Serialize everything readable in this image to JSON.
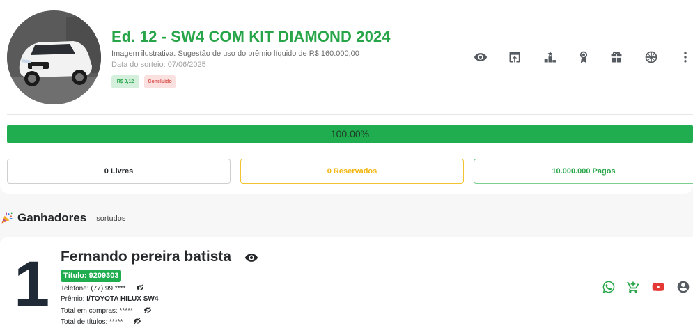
{
  "raffle": {
    "title": "Ed. 12 - SW4 COM KIT DIAMOND 2024",
    "subtitle": "Imagem ilustrativa. Sugestão de uso do prêmio líquido de R$ 160.000,00",
    "draw_date": "Data do sorteio: 07/06/2025",
    "price_badge": "R$ 0,12",
    "status_badge": "Concluído",
    "image_icon": "car-photo"
  },
  "toolbar": {
    "icons": [
      "eye-icon",
      "open-in-icon",
      "podium-icon",
      "award-icon",
      "gift-icon",
      "wheel-icon",
      "more-vert-icon"
    ]
  },
  "progress": {
    "percent": 100.0,
    "label": "100.00%"
  },
  "stats": {
    "free": "0 Livres",
    "reserved": "0 Reservados",
    "paid": "10.000.000 Pagos"
  },
  "winners": {
    "title": "Ganhadores",
    "subtitle": "sortudos",
    "items": [
      {
        "place": "1",
        "name": "Fernando pereira batista",
        "ticket": "Título: 9209303",
        "phone": "Telefone: (77) 99 ****",
        "prize_label": "Prêmio:",
        "prize": "I/TOYOTA HILUX SW4",
        "total_purchases": "Total em compras: *****",
        "total_tickets": "Total de títulos: *****"
      }
    ]
  },
  "colors": {
    "accent_green": "#27a548",
    "progress_green": "#1fad4f",
    "reserved_yellow": "#f2b611",
    "status_red": "#d9534f",
    "whatsapp_green": "#27a548",
    "youtube_red": "#e53935"
  }
}
